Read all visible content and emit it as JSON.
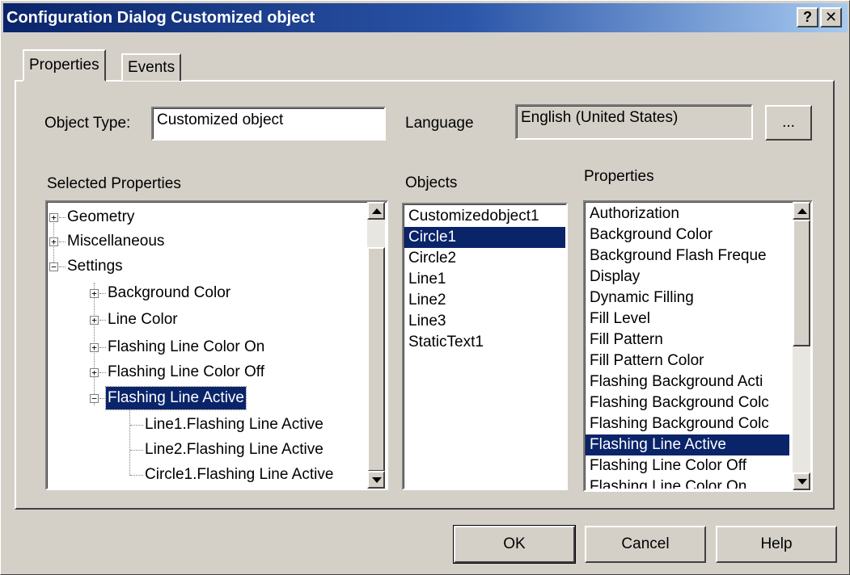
{
  "window": {
    "title": "Configuration Dialog Customized object",
    "help_glyph": "?",
    "close_glyph": "✕"
  },
  "tabs": [
    {
      "label": "Properties",
      "active": true
    },
    {
      "label": "Events",
      "active": false
    }
  ],
  "object_type": {
    "label": "Object Type:",
    "value": "Customized object"
  },
  "language": {
    "label": "Language",
    "value": "English (United States)",
    "browse_label": "..."
  },
  "selected_properties": {
    "label": "Selected Properties",
    "tree": [
      {
        "label": "Geometry",
        "expander": "+"
      },
      {
        "label": "Miscellaneous",
        "expander": "+"
      },
      {
        "label": "Settings",
        "expander": "−"
      },
      {
        "label": "Background Color",
        "expander": "+"
      },
      {
        "label": "Line Color",
        "expander": "+"
      },
      {
        "label": "Flashing Line Color On",
        "expander": "+"
      },
      {
        "label": "Flashing Line Color Off",
        "expander": "+"
      },
      {
        "label": "Flashing Line Active",
        "expander": "−",
        "selected": true
      },
      {
        "label": "Line1.Flashing Line Active"
      },
      {
        "label": "Line2.Flashing Line Active"
      },
      {
        "label": "Circle1.Flashing Line Active"
      }
    ]
  },
  "objects": {
    "label": "Objects",
    "items": [
      "Customizedobject1",
      "Circle1",
      "Circle2",
      "Line1",
      "Line2",
      "Line3",
      "StaticText1"
    ],
    "selected": "Circle1"
  },
  "properties": {
    "label": "Properties",
    "items": [
      "Authorization",
      "Background Color",
      "Background Flash Freque",
      "Display",
      "Dynamic Filling",
      "Fill Level",
      "Fill Pattern",
      "Fill Pattern Color",
      "Flashing Background Acti",
      "Flashing Background Colc",
      "Flashing Background Colc",
      "Flashing Line Active",
      "Flashing Line Color Off",
      "Flashing Line Color On"
    ],
    "selected": "Flashing Line Active"
  },
  "buttons": {
    "ok": "OK",
    "cancel": "Cancel",
    "help": "Help"
  },
  "colors": {
    "title_active": "#0a246a",
    "selection": "#0a246a",
    "face": "#d4d0c8"
  }
}
